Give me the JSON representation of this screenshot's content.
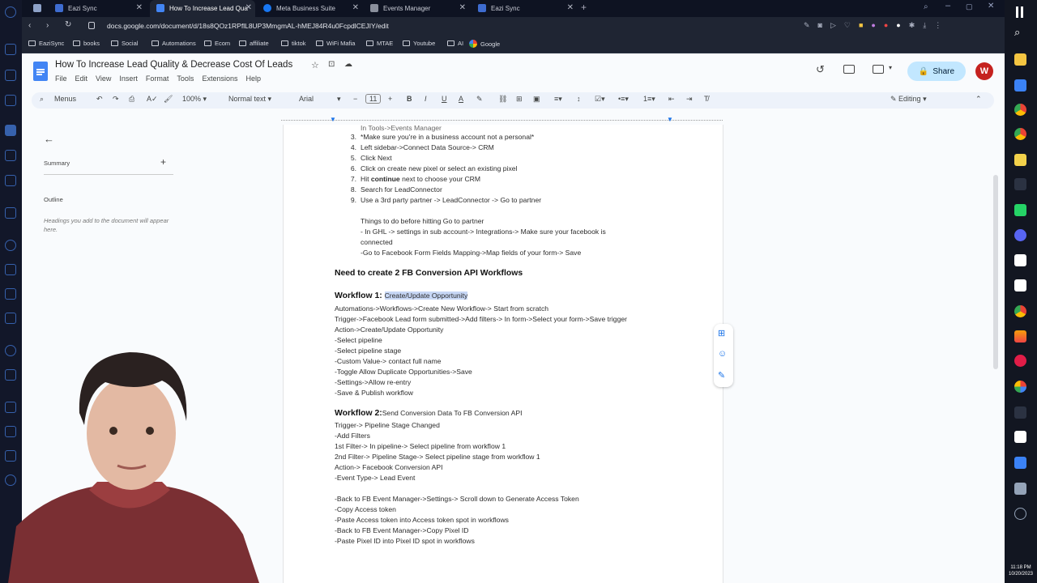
{
  "browser": {
    "tabs": [
      {
        "title": "Eazi Sync",
        "active": false
      },
      {
        "title": "How To Increase Lead Qua",
        "active": true
      },
      {
        "title": "Meta Business Suite",
        "active": false
      },
      {
        "title": "Events Manager",
        "active": false
      },
      {
        "title": "Eazi Sync",
        "active": false
      }
    ],
    "new_tab": "+",
    "url": "docs.google.com/document/d/18s8QOz1RPflL8UP3MmgmAL-hMEJ84R4u0FcpdlCEJIY/edit",
    "bookmarks": [
      "EaziSync",
      "books",
      "Social",
      "Automations",
      "Ecom",
      "affiliate",
      "tiktok",
      "WiFi Mafia",
      "MTAE",
      "Youtube",
      "AI",
      "Google"
    ]
  },
  "doc": {
    "title": "How To Increase Lead Quality & Decrease Cost Of Leads",
    "menus": [
      "File",
      "Edit",
      "View",
      "Insert",
      "Format",
      "Tools",
      "Extensions",
      "Help"
    ],
    "share_label": "Share",
    "avatar_letter": "W",
    "toolbar": {
      "menus_label": "Menus",
      "zoom": "100%",
      "style": "Normal text",
      "font": "Arial",
      "font_size": "11",
      "mode": "Editing"
    },
    "outline": {
      "summary_label": "Summary",
      "outline_label": "Outline",
      "empty_hint": "Headings you add to the document will appear here."
    },
    "body": {
      "partial_top": "In Tools->Events Manager",
      "steps": [
        {
          "n": "3.",
          "text": "*Make sure you're in a business account not a personal*"
        },
        {
          "n": "4.",
          "text": "Left sidebar->Connect Data Source-> CRM"
        },
        {
          "n": "5.",
          "text": "Click Next"
        },
        {
          "n": "6.",
          "text": "Click on create new pixel or select an existing pixel"
        },
        {
          "n": "7.",
          "text_pre": "Hit ",
          "text_bold": "continue",
          "text_post": " next to choose your CRM"
        },
        {
          "n": "8.",
          "text": "Search for LeadConnector"
        },
        {
          "n": "9.",
          "text": "Use a 3rd party partner -> LeadConnector -> Go to partner"
        }
      ],
      "todo_title": "Things to do before hitting Go to partner",
      "todo_1": "- In GHL -> settings in sub account-> Integrations-> Make sure your facebook is",
      "todo_1b": "connected",
      "todo_2": "-Go to Facebook Form Fields Mapping->Map fields of your form-> Save",
      "heading": "Need to create 2 FB Conversion API Workflows",
      "wf1_label": "Workflow 1: ",
      "wf1_title": "Create/Update Opportunity",
      "wf1_lines": [
        "Automations->Workflows->Create New Workflow-> Start from scratch",
        "Trigger->Facebook Lead form submitted->Add filters-> In form->Select your form->Save trigger",
        "Action->Create/Update Opportunity",
        "-Select pipeline",
        "-Select pipeline stage",
        "-Custom Value-> contact full name",
        "-Toggle Allow Duplicate Opportunities->Save",
        "-Settings->Allow re-entry",
        "-Save & Publish workflow"
      ],
      "wf2_label": "Workflow 2:",
      "wf2_title": "Send Conversion Data To FB Conversion API",
      "wf2_lines": [
        "Trigger-> Pipeline Stage Changed",
        "-Add Filters",
        "1st Filter-> In pipeline-> Select pipeline from workflow 1",
        "2nd Filter-> Pipeline Stage-> Select pipeline stage from workflow 1",
        "Action-> Facebook  Conversion API",
        "-Event Type-> Lead Event"
      ],
      "wf3_lines": [
        "-Back to FB Event Manager->Settings-> Scroll down to Generate Access Token",
        "-Copy Access token",
        "-Paste Access token into Access token spot in workflows",
        "-Back to FB Event Manager->Copy Pixel ID",
        "-Paste Pixel ID into Pixel ID spot in workflows"
      ]
    }
  },
  "system": {
    "time": "11:18 PM",
    "date": "10/20/2023"
  },
  "colors": {
    "accent": "#1a73e8",
    "share_bg": "#c2e7ff",
    "avatar": "#c5221f",
    "highlight": "#c7d7f5"
  }
}
